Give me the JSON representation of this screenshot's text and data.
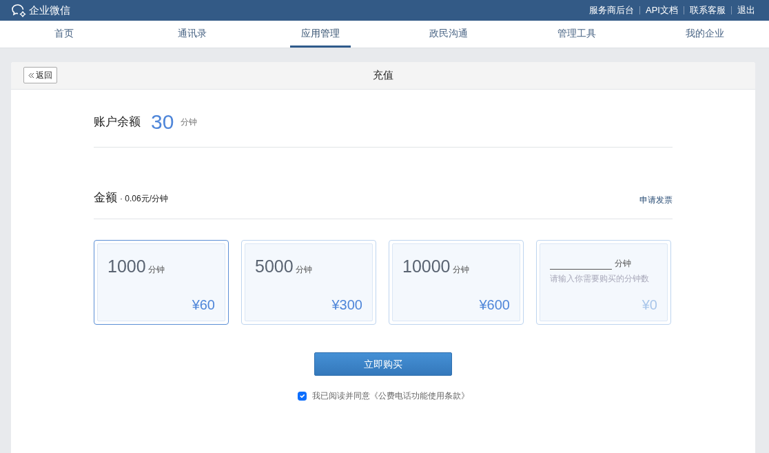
{
  "brand": {
    "name": "企业微信"
  },
  "top_links": [
    "服务商后台",
    "API文档",
    "联系客服",
    "退出"
  ],
  "tabs": [
    {
      "label": "首页",
      "selected": false
    },
    {
      "label": "通讯录",
      "selected": false
    },
    {
      "label": "应用管理",
      "selected": true
    },
    {
      "label": "政民沟通",
      "selected": false
    },
    {
      "label": "管理工具",
      "selected": false
    },
    {
      "label": "我的企业",
      "selected": false
    }
  ],
  "panel": {
    "back_label": "返回",
    "title": "充值"
  },
  "balance": {
    "label": "账户余额",
    "value": "30",
    "unit": "分钟"
  },
  "amount": {
    "label": "金额",
    "rate": "· 0.06元/分钟",
    "invoice_link": "申请发票"
  },
  "packages": [
    {
      "kind": "fixed",
      "minutes": "1000",
      "unit": "分钟",
      "price": "¥60",
      "selected": true
    },
    {
      "kind": "fixed",
      "minutes": "5000",
      "unit": "分钟",
      "price": "¥300",
      "selected": false
    },
    {
      "kind": "fixed",
      "minutes": "10000",
      "unit": "分钟",
      "price": "¥600",
      "selected": false
    },
    {
      "kind": "custom",
      "unit": "分钟",
      "placeholder": "请输入你需要购买的分钟数",
      "price": "¥0",
      "selected": false
    }
  ],
  "buy_button": "立即购买",
  "agreement": {
    "text": "我已阅读并同意《公费电话功能使用条款》",
    "checked": true
  }
}
